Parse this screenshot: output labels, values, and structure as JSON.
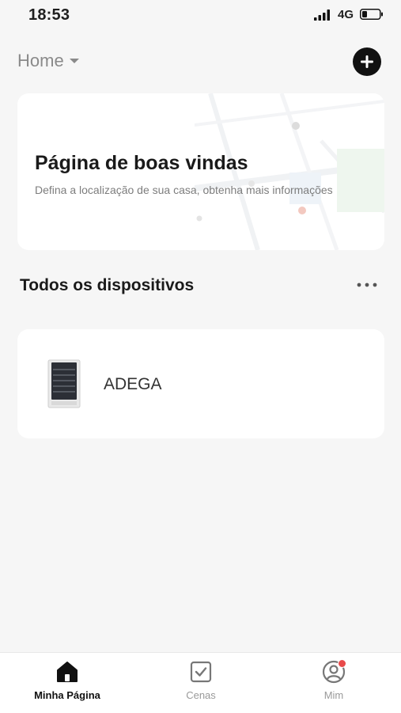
{
  "status_bar": {
    "time": "18:53",
    "network": "4G",
    "signal_icon": "signal-bars-icon",
    "battery_icon": "battery-icon"
  },
  "header": {
    "home_label": "Home",
    "caret_icon": "caret-down-icon",
    "add_icon": "plus-circle-icon"
  },
  "welcome_card": {
    "title": "Página de boas vindas",
    "subtitle": "Defina a localização de sua casa, obtenha mais informações"
  },
  "devices_section": {
    "title": "Todos os dispositivos",
    "more_icon": "more-dots-icon",
    "devices": [
      {
        "name": "ADEGA",
        "icon": "wine-cooler-icon"
      }
    ]
  },
  "tab_bar": {
    "tabs": [
      {
        "label": "Minha Página",
        "icon": "home-icon",
        "active": true
      },
      {
        "label": "Cenas",
        "icon": "checkbox-icon",
        "active": false
      },
      {
        "label": "Mim",
        "icon": "profile-icon",
        "active": false,
        "has_notification": true
      }
    ]
  },
  "colors": {
    "background": "#f6f6f6",
    "card": "#ffffff",
    "accent_dark": "#111111",
    "notification": "#e84a4a",
    "muted_text": "#8a8a8a"
  }
}
